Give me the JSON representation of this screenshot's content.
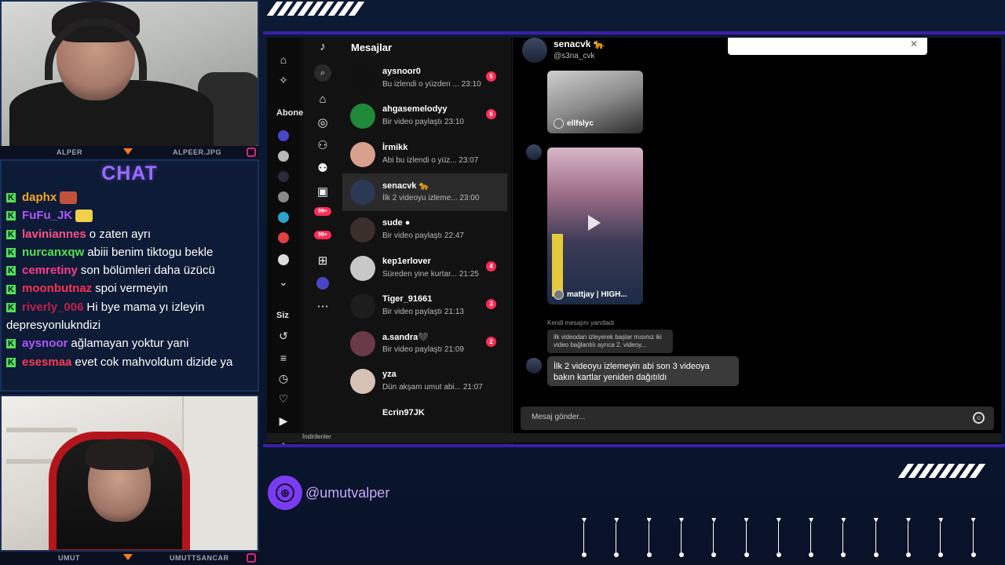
{
  "cams": {
    "top": {
      "left_name": "ALPER",
      "right_name": "ALPEER.JPG"
    },
    "bottom": {
      "left_name": "UMUT",
      "right_name": "UMUTTSANCAR"
    }
  },
  "chat": {
    "title": "CHAT",
    "messages": [
      {
        "user": "daphx",
        "text": "",
        "color": "#f5a623"
      },
      {
        "user": "FuFu_JK",
        "text": "",
        "color": "#b155ff"
      },
      {
        "user": "laviniannes",
        "text": "o zaten ayrı",
        "color": "#ff4f86"
      },
      {
        "user": "nurcanxqw",
        "text": "abiii benim tiktogu bekle",
        "color": "#52e252"
      },
      {
        "user": "cemretiny",
        "text": "son bölümleri daha üzücü",
        "color": "#ff3c8c"
      },
      {
        "user": "moonbutnaz",
        "text": "spoi vermeyin",
        "color": "#ff2f55"
      },
      {
        "user": "riverly_006",
        "text": "Hi bye mama yı izleyin depresyonlukndizi",
        "color": "#c21f4a"
      },
      {
        "user": "aysnoor",
        "text": "ağlamayan yoktur yani",
        "color": "#b155ff"
      },
      {
        "user": "esesmaa",
        "text": "evet cok mahvoldum dizide ya",
        "color": "#ff3a55"
      }
    ]
  },
  "tiktok": {
    "rail": {
      "abone_label": "Abonel",
      "siz_label": "Siz",
      "badge_1": "99+",
      "badge_2": "99+"
    },
    "conversations_title": "Mesajlar",
    "conversations": [
      {
        "name": "aysnoor0",
        "preview": "Bu izlendi o yüzden ... 23:10",
        "unread": "5",
        "avatar": "#111111"
      },
      {
        "name": "ahgasemelodyy",
        "preview": "Bir video paylaştı 23:10",
        "unread": "6",
        "avatar": "#1f8a3a"
      },
      {
        "name": "İrmikk",
        "preview": "Abi bu izlendi o yüz... 23:07",
        "unread": "",
        "avatar": "#d9a08c"
      },
      {
        "name": "senacvk 🐆",
        "preview": "İlk 2 videoyu izleme... 23:00",
        "unread": "",
        "avatar": "#2c3954"
      },
      {
        "name": "sude ●",
        "preview": "Bir video paylaştı 22:47",
        "unread": "",
        "avatar": "#3b2f2c"
      },
      {
        "name": "kep1erlover",
        "preview": "Süreden yine kurtar... 21:25",
        "unread": "4",
        "avatar": "#c8c8c8"
      },
      {
        "name": "Tiger_91661",
        "preview": "Bir video paylaştı 21:13",
        "unread": "3",
        "avatar": "#1d1d1d"
      },
      {
        "name": "a.sandra🖤",
        "preview": "Bir video paylaştı 21:09",
        "unread": "2",
        "avatar": "#6a3b47"
      },
      {
        "name": "yza",
        "preview": "Dün akşam umut abi... 21:07",
        "unread": "",
        "avatar": "#d6c3b5"
      },
      {
        "name": "Ecrin97JK",
        "preview": "",
        "unread": "",
        "avatar": "#121212"
      }
    ],
    "thread": {
      "name": "senacvk 🐆",
      "handle": "@s3na_cvk",
      "card1_tag": "ellfslyc",
      "card2_tag": "mattjay | HIGH...",
      "reply_note": "Kendi mesajını yanıtladı",
      "quoted_text": "ilk videodan izleyerek başlar mısınız iki video bağlantılı ayrıca 2. videoy...",
      "message": "İlk 2 videoyu izlemeyin abi son 3 videoya bakın kartlar yeniden dağıtıldı",
      "composer_placeholder": "Mesaj gönder..."
    },
    "downloads_label": "İndirilenler"
  },
  "overlay": {
    "social_handle": "@umutvalper"
  },
  "colors": {
    "accent_purple": "#3c1ea8",
    "tiktok_red": "#fe2c55",
    "kick_green": "#52e252"
  }
}
